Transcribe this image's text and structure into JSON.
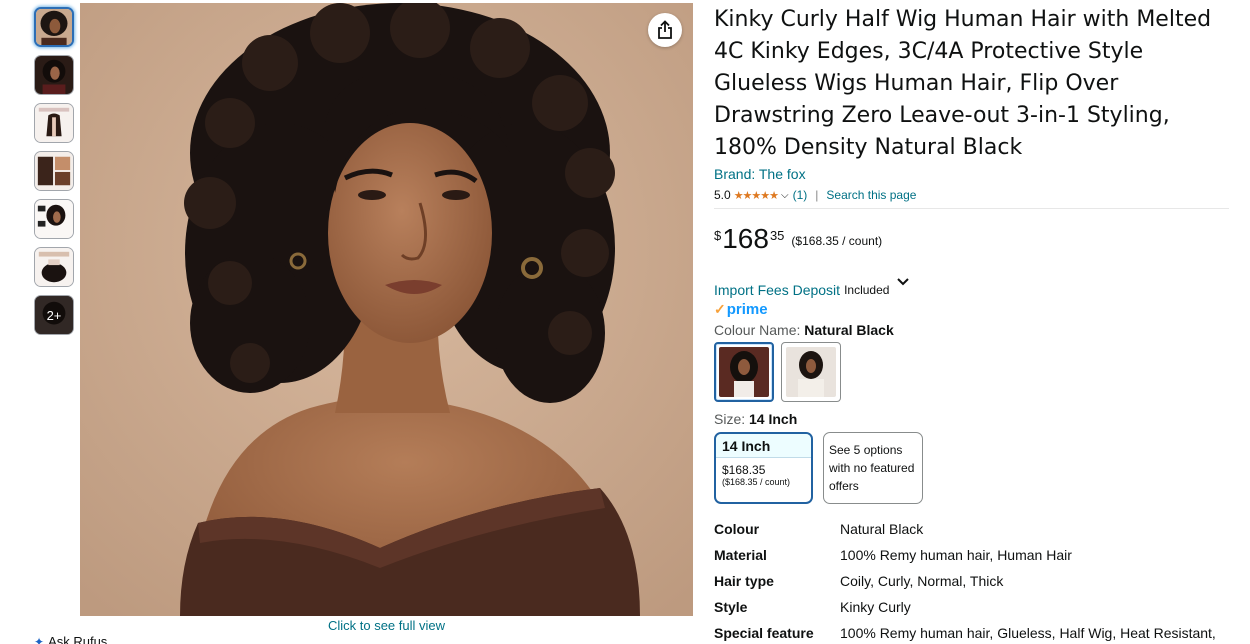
{
  "gallery": {
    "more_label": "2+",
    "full_view_label": "Click to see full view",
    "ask_rufus_label": "Ask Rufus"
  },
  "product": {
    "title": "Kinky Curly Half Wig Human Hair with Melted 4C Kinky Edges, 3C/4A Protective Style Glueless Wigs Human Hair, Flip Over Drawstring Zero Leave-out 3-in-1 Styling, 180% Density Natural Black",
    "brand": "Brand: The fox",
    "rating_value": "5.0",
    "rating_stars": "★★★★★",
    "rating_count": "(1)",
    "search_page": "Search this page",
    "price_symbol": "$",
    "price_whole": "168",
    "price_fraction": "35",
    "unit_price": "($168.35 / count)",
    "import_fees_label": "Import Fees Deposit",
    "import_fees_status": "Included",
    "prime_label": "prime",
    "colour_label": "Colour Name:",
    "colour_value": "Natural Black",
    "size_label": "Size:",
    "size_value": "14 Inch",
    "size_option": {
      "title": "14 Inch",
      "price": "$168.35",
      "unit": "($168.35 / count)"
    },
    "other_options": "See 5 options with no featured offers"
  },
  "specs": [
    {
      "key": "Colour",
      "value": "Natural Black"
    },
    {
      "key": "Material",
      "value": "100% Remy human hair, Human Hair"
    },
    {
      "key": "Hair type",
      "value": "Coily, Curly, Normal, Thick"
    },
    {
      "key": "Style",
      "value": "Kinky Curly"
    },
    {
      "key": "Special feature",
      "value": "100% Remy human hair, Glueless, Half Wig, Heat Resistant,"
    }
  ],
  "colors": {
    "link": "#007185",
    "star": "#de7921",
    "prime": "#1399ff",
    "selected_border": "#2162a1"
  },
  "icons": [
    "share-icon",
    "chevron-down-icon",
    "prime-check-icon",
    "rufus-spark-icon"
  ]
}
